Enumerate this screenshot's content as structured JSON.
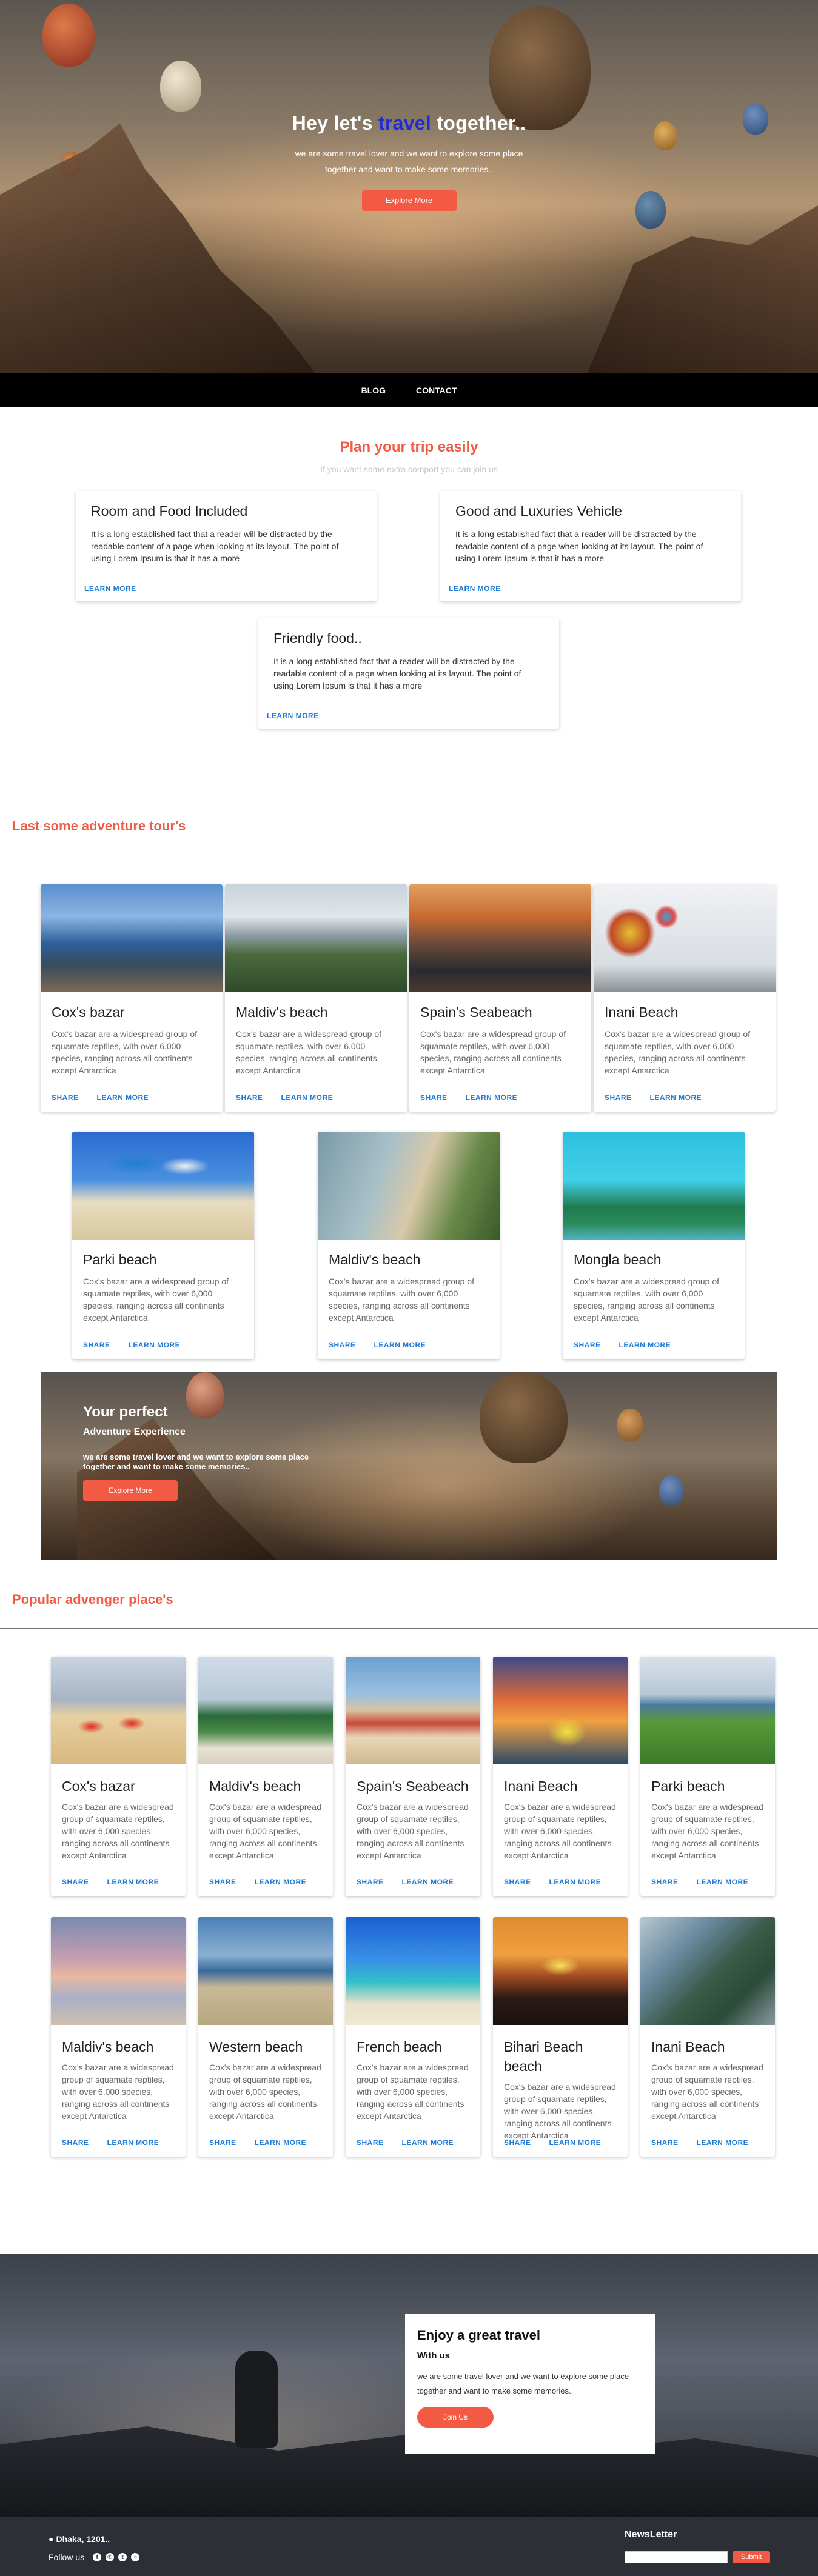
{
  "hero": {
    "title_pre": "Hey let's",
    "title_accent": "travel",
    "title_post": "together..",
    "text": "we are some travel lover and we want to explore some place together and want to make some memories..",
    "button": "Explore More"
  },
  "nav": {
    "items": [
      "BLOG",
      "CONTACT"
    ]
  },
  "plan": {
    "title": "Plan your trip easily",
    "subtitle": "If you want some extra comport you can join us",
    "cards": [
      {
        "title": "Room and Food Included",
        "text": "It is a long established fact that a reader will be distracted by the readable content of a page when looking at its layout. The point of using Lorem Ipsum is that it has a more",
        "link": "LEARN MORE"
      },
      {
        "title": "Good and Luxuries Vehicle",
        "text": "It is a long established fact that a reader will be distracted by the readable content of a page when looking at its layout. The point of using Lorem Ipsum is that it has a more",
        "link": "LEARN MORE"
      },
      {
        "title": "Friendly food..",
        "text": "It is a long established fact that a reader will be distracted by the readable content of a page when looking at its layout. The point of using Lorem Ipsum is that it has a more",
        "link": "LEARN MORE"
      }
    ]
  },
  "tours": {
    "title": "Last some adventure tour's",
    "cards": [
      {
        "title": "Cox's bazar",
        "text": "Cox's bazar are a widespread group of squamate reptiles, with over 6,000 species, ranging across all continents except Antarctica",
        "share": "SHARE",
        "link": "LEARN MORE"
      },
      {
        "title": "Maldiv's beach",
        "text": "Cox's bazar are a widespread group of squamate reptiles, with over 6,000 species, ranging across all continents except Antarctica",
        "share": "SHARE",
        "link": "LEARN MORE"
      },
      {
        "title": "Spain's Seabeach",
        "text": "Cox's bazar are a widespread group of squamate reptiles, with over 6,000 species, ranging across all continents except Antarctica",
        "share": "SHARE",
        "link": "LEARN MORE"
      },
      {
        "title": "Inani Beach",
        "text": "Cox's bazar are a widespread group of squamate reptiles, with over 6,000 species, ranging across all continents except Antarctica",
        "share": "SHARE",
        "link": "LEARN MORE"
      },
      {
        "title": "Parki beach",
        "text": "Cox's bazar are a widespread group of squamate reptiles, with over 6,000 species, ranging across all continents except Antarctica",
        "share": "SHARE",
        "link": "LEARN MORE"
      },
      {
        "title": "Maldiv's beach",
        "text": "Cox's bazar are a widespread group of squamate reptiles, with over 6,000 species, ranging across all continents except Antarctica",
        "share": "SHARE",
        "link": "LEARN MORE"
      },
      {
        "title": "Mongla beach",
        "text": "Cox's bazar are a widespread group of squamate reptiles, with over 6,000 species, ranging across all continents except Antarctica",
        "share": "SHARE",
        "link": "LEARN MORE"
      }
    ]
  },
  "perfect": {
    "title": "Your perfect",
    "subtitle": "Adventure Experience",
    "text": "we are some travel lover and we want to explore some place together and want to make some memories..",
    "button": "Explore More"
  },
  "popular": {
    "title": "Popular advenger place's",
    "cards": [
      {
        "title": "Cox's bazar",
        "text": "Cox's bazar are a widespread group of squamate reptiles, with over 6,000 species, ranging across all continents except Antarctica",
        "share": "SHARE",
        "link": "LEARN MORE"
      },
      {
        "title": "Maldiv's beach",
        "text": "Cox's bazar are a widespread group of squamate reptiles, with over 6,000 species, ranging across all continents except Antarctica",
        "share": "SHARE",
        "link": "LEARN MORE"
      },
      {
        "title": "Spain's Seabeach",
        "text": "Cox's bazar are a widespread group of squamate reptiles, with over 6,000 species, ranging across all continents except Antarctica",
        "share": "SHARE",
        "link": "LEARN MORE"
      },
      {
        "title": "Inani Beach",
        "text": "Cox's bazar are a widespread group of squamate reptiles, with over 6,000 species, ranging across all continents except Antarctica",
        "share": "SHARE",
        "link": "LEARN MORE"
      },
      {
        "title": "Parki beach",
        "text": "Cox's bazar are a widespread group of squamate reptiles, with over 6,000 species, ranging across all continents except Antarctica",
        "share": "SHARE",
        "link": "LEARN MORE"
      },
      {
        "title": "Maldiv's beach",
        "text": "Cox's bazar are a widespread group of squamate reptiles, with over 6,000 species, ranging across all continents except Antarctica",
        "share": "SHARE",
        "link": "LEARN MORE"
      },
      {
        "title": "Western beach",
        "text": "Cox's bazar are a widespread group of squamate reptiles, with over 6,000 species, ranging across all continents except Antarctica",
        "share": "SHARE",
        "link": "LEARN MORE"
      },
      {
        "title": "French beach",
        "text": "Cox's bazar are a widespread group of squamate reptiles, with over 6,000 species, ranging across all continents except Antarctica",
        "share": "SHARE",
        "link": "LEARN MORE"
      },
      {
        "title": "Bihari Beach beach",
        "text": "Cox's bazar are a widespread group of squamate reptiles, with over 6,000 species, ranging across all continents except Antarctica",
        "share": "SHARE",
        "link": "LEARN MORE"
      },
      {
        "title": "Inani Beach",
        "text": "Cox's bazar are a widespread group of squamate reptiles, with over 6,000 species, ranging across all continents except Antarctica",
        "share": "SHARE",
        "link": "LEARN MORE"
      }
    ]
  },
  "enjoy": {
    "title": "Enjoy a great travel",
    "subtitle": "With us",
    "text": "we are some travel lover and we want to explore some place together and want to make some memories..",
    "button": "Join Us"
  },
  "footer": {
    "address": "Dhaka, 1201..",
    "follow": "Follow us",
    "social_icons": [
      "facebook-icon",
      "whatsapp-icon",
      "twitter-icon",
      "instagram-icon"
    ],
    "newsletter_title": "NewsLetter",
    "newsletter_placeholder": "",
    "submit": "Submit"
  },
  "colors": {
    "accent": "#f25a43",
    "link": "#1e7bd6",
    "title_accent": "#1f2bd8",
    "nav_bg": "#000000",
    "footer_bg": "#2c2f36"
  }
}
